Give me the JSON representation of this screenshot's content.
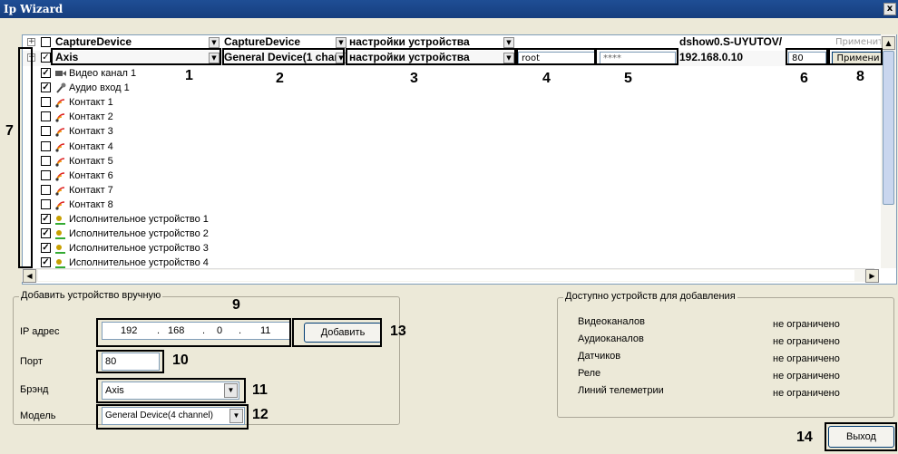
{
  "window": {
    "title": "Ip Wizard",
    "close_glyph": "x"
  },
  "tree": {
    "header_row": {
      "device": "CaptureDevice",
      "model": "CaptureDevice",
      "settings": "настройки устройства",
      "host": "dshow0.S-UYUTOV/",
      "apply_label": "Применить"
    },
    "axis_row": {
      "brand": "Axis",
      "model": "General Device(1 chan",
      "settings": "настройки устройства",
      "login": "root",
      "password": "****",
      "ip": "192.168.0.10",
      "port": "80",
      "apply_label": "Примени"
    },
    "subitems": [
      {
        "label": "Видео канал 1",
        "checked": true,
        "icon": "video-camera-icon"
      },
      {
        "label": "Аудио вход 1",
        "checked": true,
        "icon": "microphone-icon"
      },
      {
        "label": "Контакт 1",
        "checked": false,
        "icon": "sensor-icon"
      },
      {
        "label": "Контакт 2",
        "checked": false,
        "icon": "sensor-icon"
      },
      {
        "label": "Контакт 3",
        "checked": false,
        "icon": "sensor-icon"
      },
      {
        "label": "Контакт 4",
        "checked": false,
        "icon": "sensor-icon"
      },
      {
        "label": "Контакт 5",
        "checked": false,
        "icon": "sensor-icon"
      },
      {
        "label": "Контакт 6",
        "checked": false,
        "icon": "sensor-icon"
      },
      {
        "label": "Контакт 7",
        "checked": false,
        "icon": "sensor-icon"
      },
      {
        "label": "Контакт 8",
        "checked": false,
        "icon": "sensor-icon"
      },
      {
        "label": "Исполнительное устройство 1",
        "checked": true,
        "icon": "relay-icon"
      },
      {
        "label": "Исполнительное устройство 2",
        "checked": true,
        "icon": "relay-icon"
      },
      {
        "label": "Исполнительное устройство 3",
        "checked": true,
        "icon": "relay-icon"
      },
      {
        "label": "Исполнительное устройство 4",
        "checked": true,
        "icon": "relay-icon"
      }
    ]
  },
  "callouts": [
    "1",
    "2",
    "3",
    "4",
    "5",
    "6",
    "7",
    "8",
    "9",
    "10",
    "11",
    "12",
    "13",
    "14"
  ],
  "manual_add": {
    "group_title": "Добавить устройство вручную",
    "ip_label": "IP адрес",
    "ip_octets": [
      "192",
      "168",
      "0",
      "11"
    ],
    "port_label": "Порт",
    "port_value": "80",
    "brand_label": "Брэнд",
    "brand_value": "Axis",
    "model_label": "Модель",
    "model_value": "General Device(4 channel)",
    "add_button": "Добавить"
  },
  "available": {
    "group_title": "Доступно устройств для добавления",
    "rows": [
      {
        "label": "Видеоканалов",
        "value": "не ограничено"
      },
      {
        "label": "Аудиоканалов",
        "value": "не ограничено"
      },
      {
        "label": "Датчиков",
        "value": "не ограничено"
      },
      {
        "label": "Реле",
        "value": "не ограничено"
      },
      {
        "label": "Линий телеметрии",
        "value": "не ограничено"
      }
    ]
  },
  "exit_button": "Выход"
}
